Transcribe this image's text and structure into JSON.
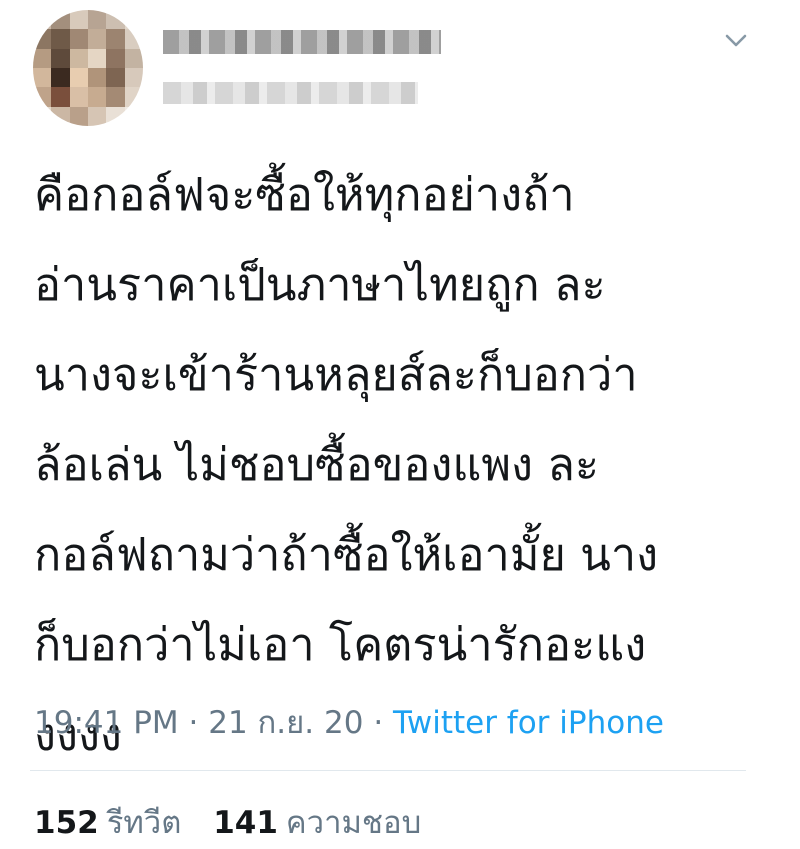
{
  "tweet": {
    "lines": [
      "คือกอล์ฟจะซื้อให้ทุกอย่างถ้า",
      "อ่านราคาเป็นภาษาไทยถูก ละ",
      "นางจะเข้าร้านหลุยส์ละก็บอกว่า",
      "ล้อเล่น ไม่ชอบซื้อของแพง ละ",
      "กอล์ฟถามว่าถ้าซื้อให้เอามั้ย นาง",
      "ก็บอกว่าไม่เอา โคตรน่ารักอะแง",
      "งงงง"
    ],
    "time": "19:41 PM",
    "separator": "·",
    "date": "21 ก.ย. 20",
    "source": "Twitter for iPhone"
  },
  "stats": {
    "retweets_count": "152",
    "retweets_label": "รีทวีต",
    "likes_count": "141",
    "likes_label": "ความชอบ"
  },
  "icons": {
    "menu": "chevron-down-icon"
  },
  "colors": {
    "link": "#1da1f2",
    "muted": "#657786",
    "text": "#14171a"
  }
}
